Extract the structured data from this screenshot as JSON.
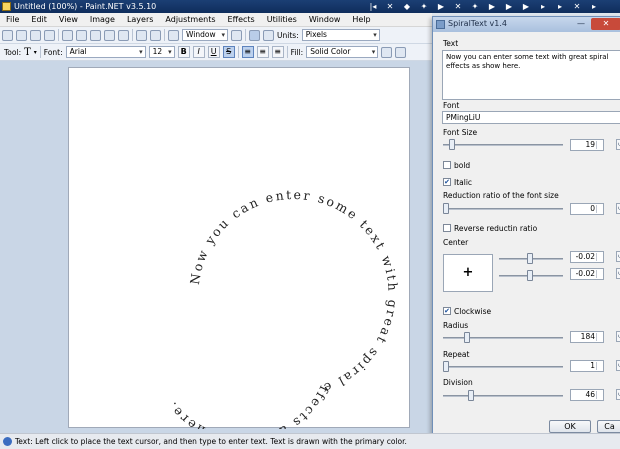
{
  "titlebar": {
    "title": "Untitled (100%) - Paint.NET v3.5.10"
  },
  "topstrip": [
    "|◂",
    "✕",
    "◆",
    "✦",
    "▶",
    "✕",
    "✦",
    "▶",
    "▶",
    "▶",
    "▸",
    "▸",
    "✕",
    "▸"
  ],
  "menu": [
    "File",
    "Edit",
    "View",
    "Image",
    "Layers",
    "Adjustments",
    "Effects",
    "Utilities",
    "Window",
    "Help"
  ],
  "toolbar1": {
    "window_combo": "Window",
    "units_label": "Units:",
    "units_value": "Pixels"
  },
  "toolbar2": {
    "tool_label": "Tool:",
    "tool_glyph": "T",
    "font_label": "Font:",
    "font_value": "Arial",
    "size_value": "12",
    "bold": "B",
    "italic": "I",
    "underline": "U",
    "strike": "S",
    "fill_label": "Fill:",
    "fill_value": "Solid Color"
  },
  "spiral_text": {
    "text": "Now you can enter some text with great spiral effects as shown here."
  },
  "status": {
    "text": "Text: Left click to place the text cursor, and then type to enter text. Text is drawn with the primary color."
  },
  "dialog": {
    "title": "SpiralText v1.4",
    "close": "✕",
    "minimize": "—",
    "text_label": "Text",
    "text_value": "Now you can enter some text with great spiral effects as show here.",
    "font_label": "Font",
    "font_value": "PMingLiU",
    "font_size_label": "Font Size",
    "font_size_value": "19",
    "font_size_level": 0.05,
    "bold_label": "bold",
    "italic_label": "Italic",
    "italic_checked": true,
    "reduction_label": "Reduction ratio of the font size",
    "reduction_value": "0",
    "reduction_level": 0.0,
    "reverse_label": "Reverse reductin ratio",
    "center_label": "Center",
    "center_plus": "+",
    "center_x_value": "-0.02",
    "center_y_value": "-0.02",
    "center_x_level": 0.49,
    "center_y_level": 0.49,
    "clockwise_label": "Clockwise",
    "clockwise_checked": true,
    "radius_label": "Radius",
    "radius_value": "184",
    "radius_level": 0.18,
    "repeat_label": "Repeat",
    "repeat_value": "1",
    "repeat_level": 0.0,
    "division_label": "Division",
    "division_value": "46",
    "division_level": 0.22,
    "ok_label": "OK",
    "cancel_label": "Ca",
    "reset_glyph": "↺"
  }
}
